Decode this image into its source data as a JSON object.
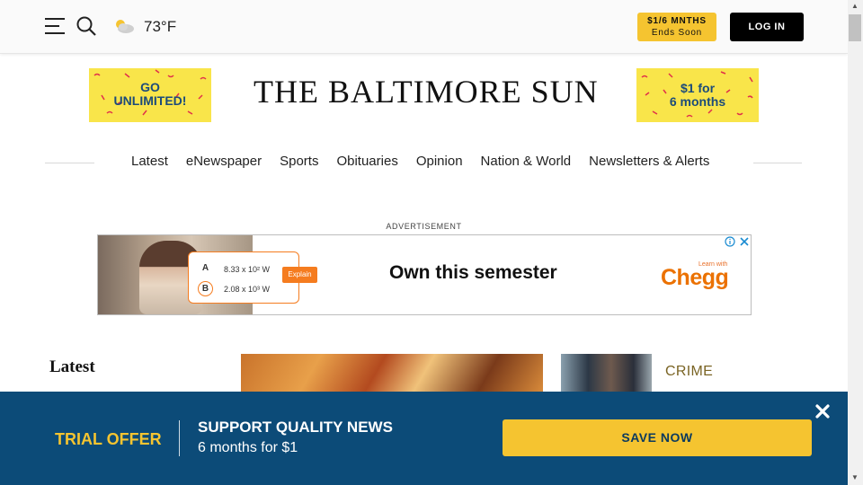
{
  "header": {
    "menu_icon": "hamburger-menu-icon",
    "search_icon": "search-icon",
    "weather_icon": "partly-cloudy-icon",
    "temperature": "73°F",
    "offer_line1": "$1/6 MNTHS",
    "offer_line2": "Ends Soon",
    "login_label": "LOG IN"
  },
  "masthead": {
    "promo_left_line1": "GO",
    "promo_left_line2": "UNLIMITED!",
    "logo_text": "THE BALTIMORE SUN",
    "promo_right_line1": "$1 for",
    "promo_right_line2": "6 months"
  },
  "nav": {
    "items": [
      "Latest",
      "eNewspaper",
      "Sports",
      "Obituaries",
      "Opinion",
      "Nation & World",
      "Newsletters & Alerts"
    ]
  },
  "ad": {
    "label": "ADVERTISEMENT",
    "choice_a": "A",
    "value_a": "8.33 x 10² W",
    "choice_b": "B",
    "value_b": "2.08 x 10³ W",
    "explain_label": "Explain",
    "headline": "Own this semester",
    "brand_small": "Learn with",
    "brand": "Chegg",
    "info_icon": "ad-info-icon",
    "close_icon": "ad-close-icon"
  },
  "content": {
    "latest_title": "Latest",
    "crime_label": "CRIME"
  },
  "trial": {
    "offer_label": "TRIAL OFFER",
    "headline": "SUPPORT QUALITY NEWS",
    "subline": "6 months for $1",
    "button_label": "SAVE NOW",
    "close_icon": "close-icon"
  },
  "colors": {
    "accent_yellow": "#f5c430",
    "trial_bar_blue": "#0c4b78",
    "chegg_orange": "#eb7100",
    "crime_gold": "#7a6424"
  }
}
